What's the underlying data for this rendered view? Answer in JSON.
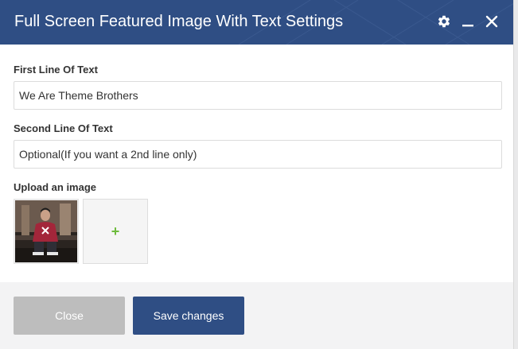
{
  "dialog": {
    "title": "Full Screen Featured Image With Text Settings",
    "header_icons": [
      "gear-icon",
      "minimize-icon",
      "close-icon"
    ]
  },
  "form": {
    "first_line": {
      "label": "First Line Of Text",
      "value": "We Are Theme Brothers"
    },
    "second_line": {
      "label": "Second Line Of Text",
      "value": "Optional(If you want a 2nd line only)"
    },
    "upload": {
      "label": "Upload an image",
      "add_symbol": "+"
    }
  },
  "footer": {
    "close_label": "Close",
    "save_label": "Save changes"
  },
  "colors": {
    "header": "#2f4e84",
    "save_button": "#2f4e84",
    "close_button": "#bdbdbd",
    "add_plus": "#6dbb3c",
    "footer_bg": "#f3f3f4"
  }
}
